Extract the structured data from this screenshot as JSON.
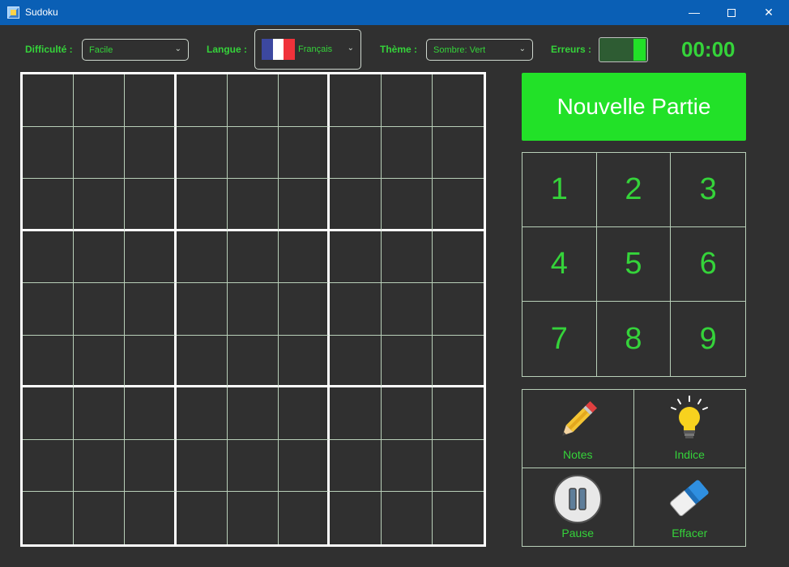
{
  "window": {
    "title": "Sudoku",
    "minimize": "—",
    "close": "✕"
  },
  "toolbar": {
    "difficulty_label": "Difficulté :",
    "difficulty_value": "Facile",
    "language_label": "Langue :",
    "language_value": "Français",
    "theme_label": "Thème :",
    "theme_value": "Sombre: Vert",
    "errors_label": "Erreurs :",
    "errors_toggle_on": true,
    "timer": "00:00",
    "chevron": "⌄"
  },
  "colors": {
    "accent": "#22e128",
    "text_accent": "#35d33a",
    "background": "#303030",
    "titlebar": "#0a5fb5",
    "flag_blue": "#3c48a0",
    "flag_white": "#ffffff",
    "flag_red": "#f0323a"
  },
  "board": {
    "cells": [
      [
        "",
        "",
        "",
        "",
        "",
        "",
        "",
        "",
        ""
      ],
      [
        "",
        "",
        "",
        "",
        "",
        "",
        "",
        "",
        ""
      ],
      [
        "",
        "",
        "",
        "",
        "",
        "",
        "",
        "",
        ""
      ],
      [
        "",
        "",
        "",
        "",
        "",
        "",
        "",
        "",
        ""
      ],
      [
        "",
        "",
        "",
        "",
        "",
        "",
        "",
        "",
        ""
      ],
      [
        "",
        "",
        "",
        "",
        "",
        "",
        "",
        "",
        ""
      ],
      [
        "",
        "",
        "",
        "",
        "",
        "",
        "",
        "",
        ""
      ],
      [
        "",
        "",
        "",
        "",
        "",
        "",
        "",
        "",
        ""
      ],
      [
        "",
        "",
        "",
        "",
        "",
        "",
        "",
        "",
        ""
      ]
    ]
  },
  "new_game_label": "Nouvelle Partie",
  "numpad": [
    "1",
    "2",
    "3",
    "4",
    "5",
    "6",
    "7",
    "8",
    "9"
  ],
  "tools": [
    {
      "label": "Notes",
      "icon": "pencil-icon"
    },
    {
      "label": "Indice",
      "icon": "lightbulb-icon"
    },
    {
      "label": "Pause",
      "icon": "pause-icon"
    },
    {
      "label": "Effacer",
      "icon": "eraser-icon"
    }
  ]
}
